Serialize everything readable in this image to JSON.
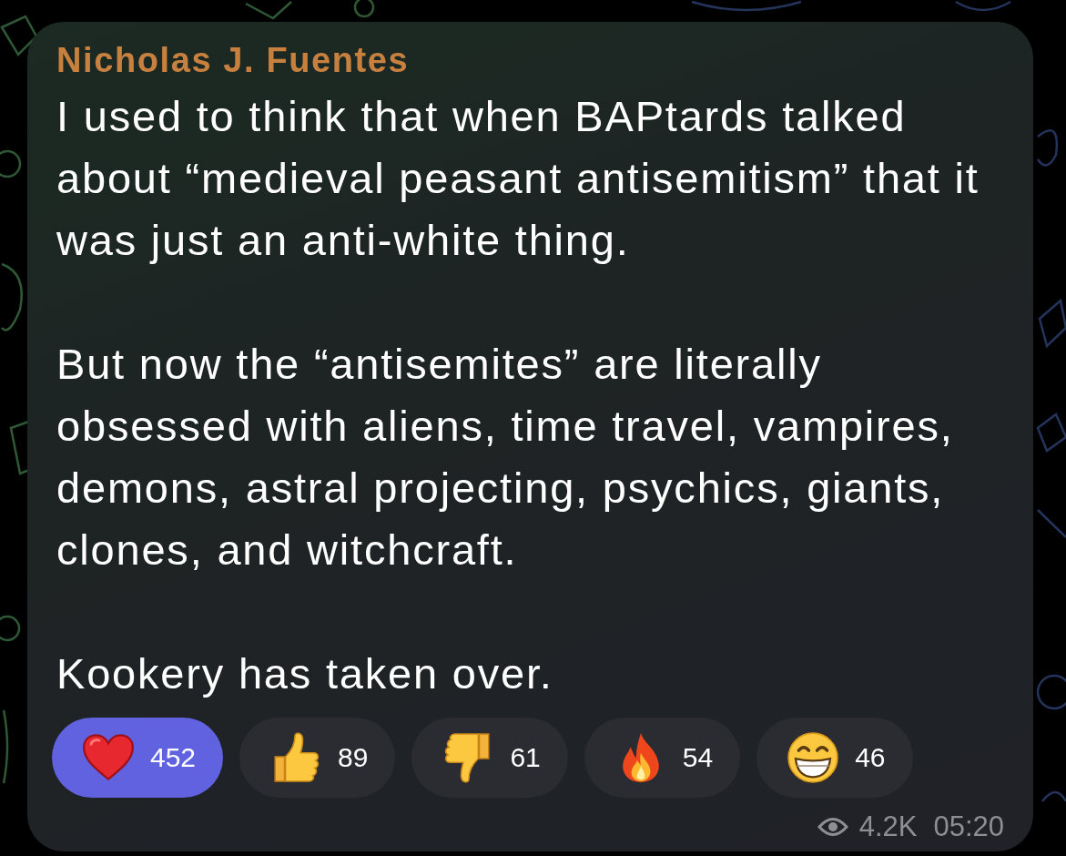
{
  "message": {
    "sender": "Nicholas J. Fuentes",
    "paragraphs": [
      "I used to think that when BAPtards talked about “medieval peasant antisemitism” that it was just an anti-white thing.",
      "But now the “antisemites” are literally obsessed with aliens, time travel, vampires, demons, astral projecting, psychics, giants, clones, and witchcraft.",
      "Kookery has taken over."
    ],
    "reactions": [
      {
        "kind": "heart",
        "count": "452",
        "selected": true
      },
      {
        "kind": "thumbs-up",
        "count": "89",
        "selected": false
      },
      {
        "kind": "thumbs-down",
        "count": "61",
        "selected": false
      },
      {
        "kind": "fire",
        "count": "54",
        "selected": false
      },
      {
        "kind": "grin",
        "count": "46",
        "selected": false
      }
    ],
    "views": "4.2K",
    "time": "05:20"
  }
}
